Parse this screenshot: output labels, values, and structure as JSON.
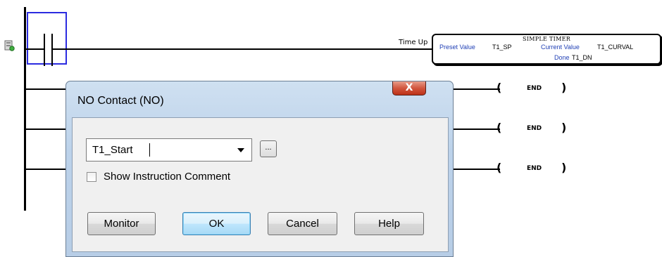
{
  "ladder": {
    "rung1_label": "Time Up",
    "timer": {
      "title": "SIMPLE TIMER",
      "preset_label": "Preset Value",
      "preset_value": "T1_SP",
      "current_label": "Current Value",
      "current_value": "T1_CURVAL",
      "done_label": "Done",
      "done_value": "T1_DN"
    },
    "end_label_1": "END",
    "end_label_2": "END",
    "end_label_3": "END"
  },
  "dialog": {
    "title": "NO Contact (NO)",
    "close_glyph": "X",
    "operand_value": "T1_Start",
    "browse_label": "...",
    "show_comment_label": "Show Instruction Comment",
    "show_comment_checked": false,
    "buttons": {
      "monitor": "Monitor",
      "ok": "OK",
      "cancel": "Cancel",
      "help": "Help"
    }
  }
}
